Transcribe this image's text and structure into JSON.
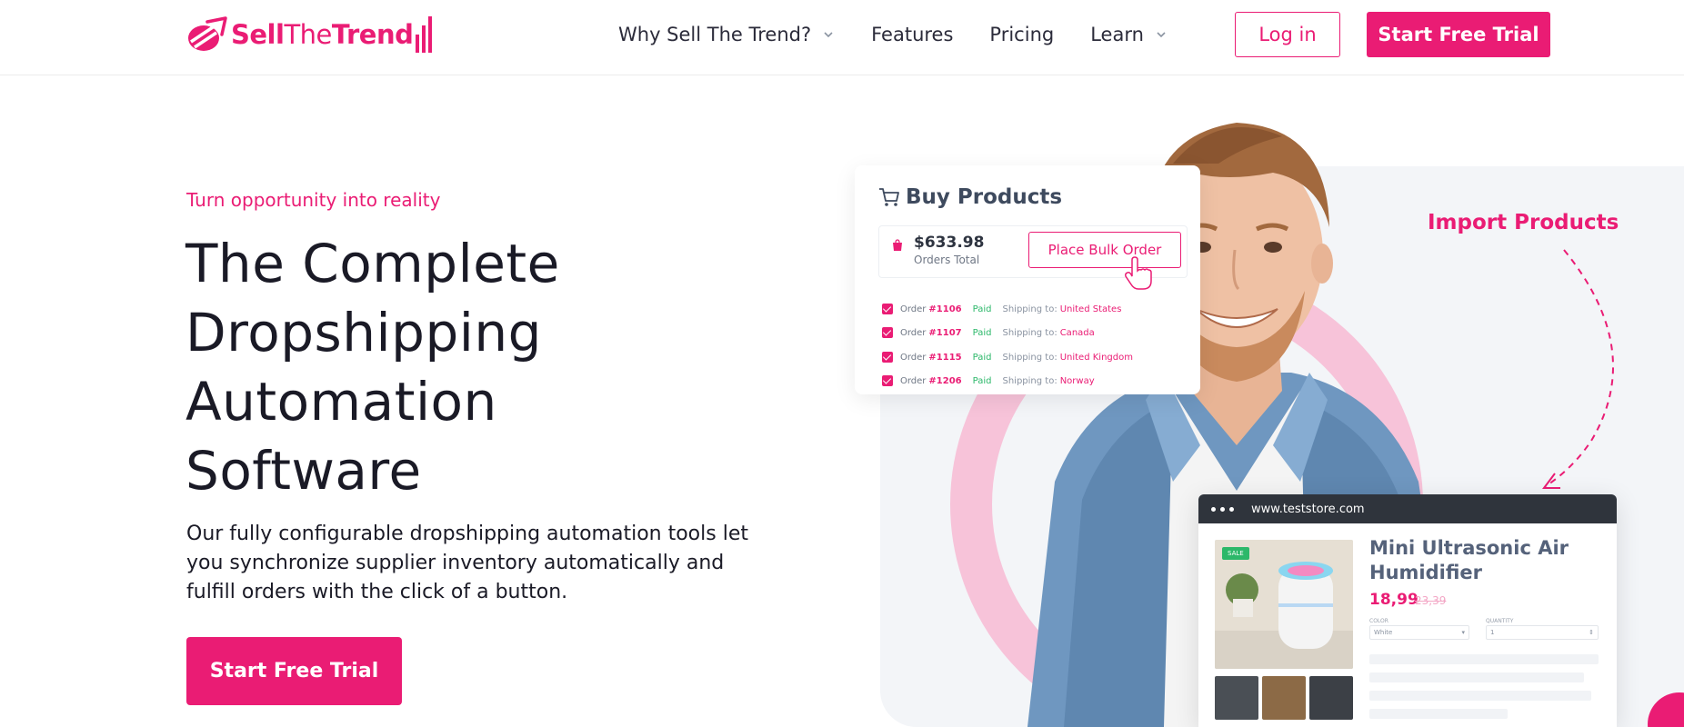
{
  "brand": {
    "name_part1": "Sell",
    "name_part2": "The",
    "name_part3": "Trend",
    "accent_color": "#ea1c74"
  },
  "nav": {
    "links": [
      {
        "label": "Why Sell The Trend?",
        "has_dropdown": true
      },
      {
        "label": "Features",
        "has_dropdown": false
      },
      {
        "label": "Pricing",
        "has_dropdown": false
      },
      {
        "label": "Learn",
        "has_dropdown": true
      }
    ],
    "login_label": "Log in",
    "trial_label": "Start Free Trial"
  },
  "hero": {
    "eyebrow": "Turn opportunity into reality",
    "title": "The Complete Dropshipping Automation Software",
    "description": "Our fully configurable dropshipping automation tools let you synchronize supplier inventory automatically and fulfill orders with the click of a button.",
    "cta_label": "Start Free Trial"
  },
  "buy_products": {
    "title": "Buy Products",
    "amount": "$633.98",
    "amount_label": "Orders Total",
    "button_label": "Place Bulk Order",
    "orders": [
      {
        "label": "Order",
        "number": "#1106",
        "status": "Paid",
        "ship_label": "Shipping to:",
        "country": "United States"
      },
      {
        "label": "Order",
        "number": "#1107",
        "status": "Paid",
        "ship_label": "Shipping to:",
        "country": "Canada"
      },
      {
        "label": "Order",
        "number": "#1115",
        "status": "Paid",
        "ship_label": "Shipping to:",
        "country": "United Kingdom"
      },
      {
        "label": "Order",
        "number": "#1206",
        "status": "Paid",
        "ship_label": "Shipping to:",
        "country": "Norway"
      }
    ]
  },
  "import_label": "Import Products",
  "product": {
    "url": "www.teststore.com",
    "badge": "SALE",
    "name": "Mini Ultrasonic Air Humidifier",
    "price": "18,99",
    "old_price": "23,39",
    "color_label": "COLOR",
    "color_value": "White",
    "quantity_label": "QUANTITY",
    "quantity_value": "1"
  }
}
